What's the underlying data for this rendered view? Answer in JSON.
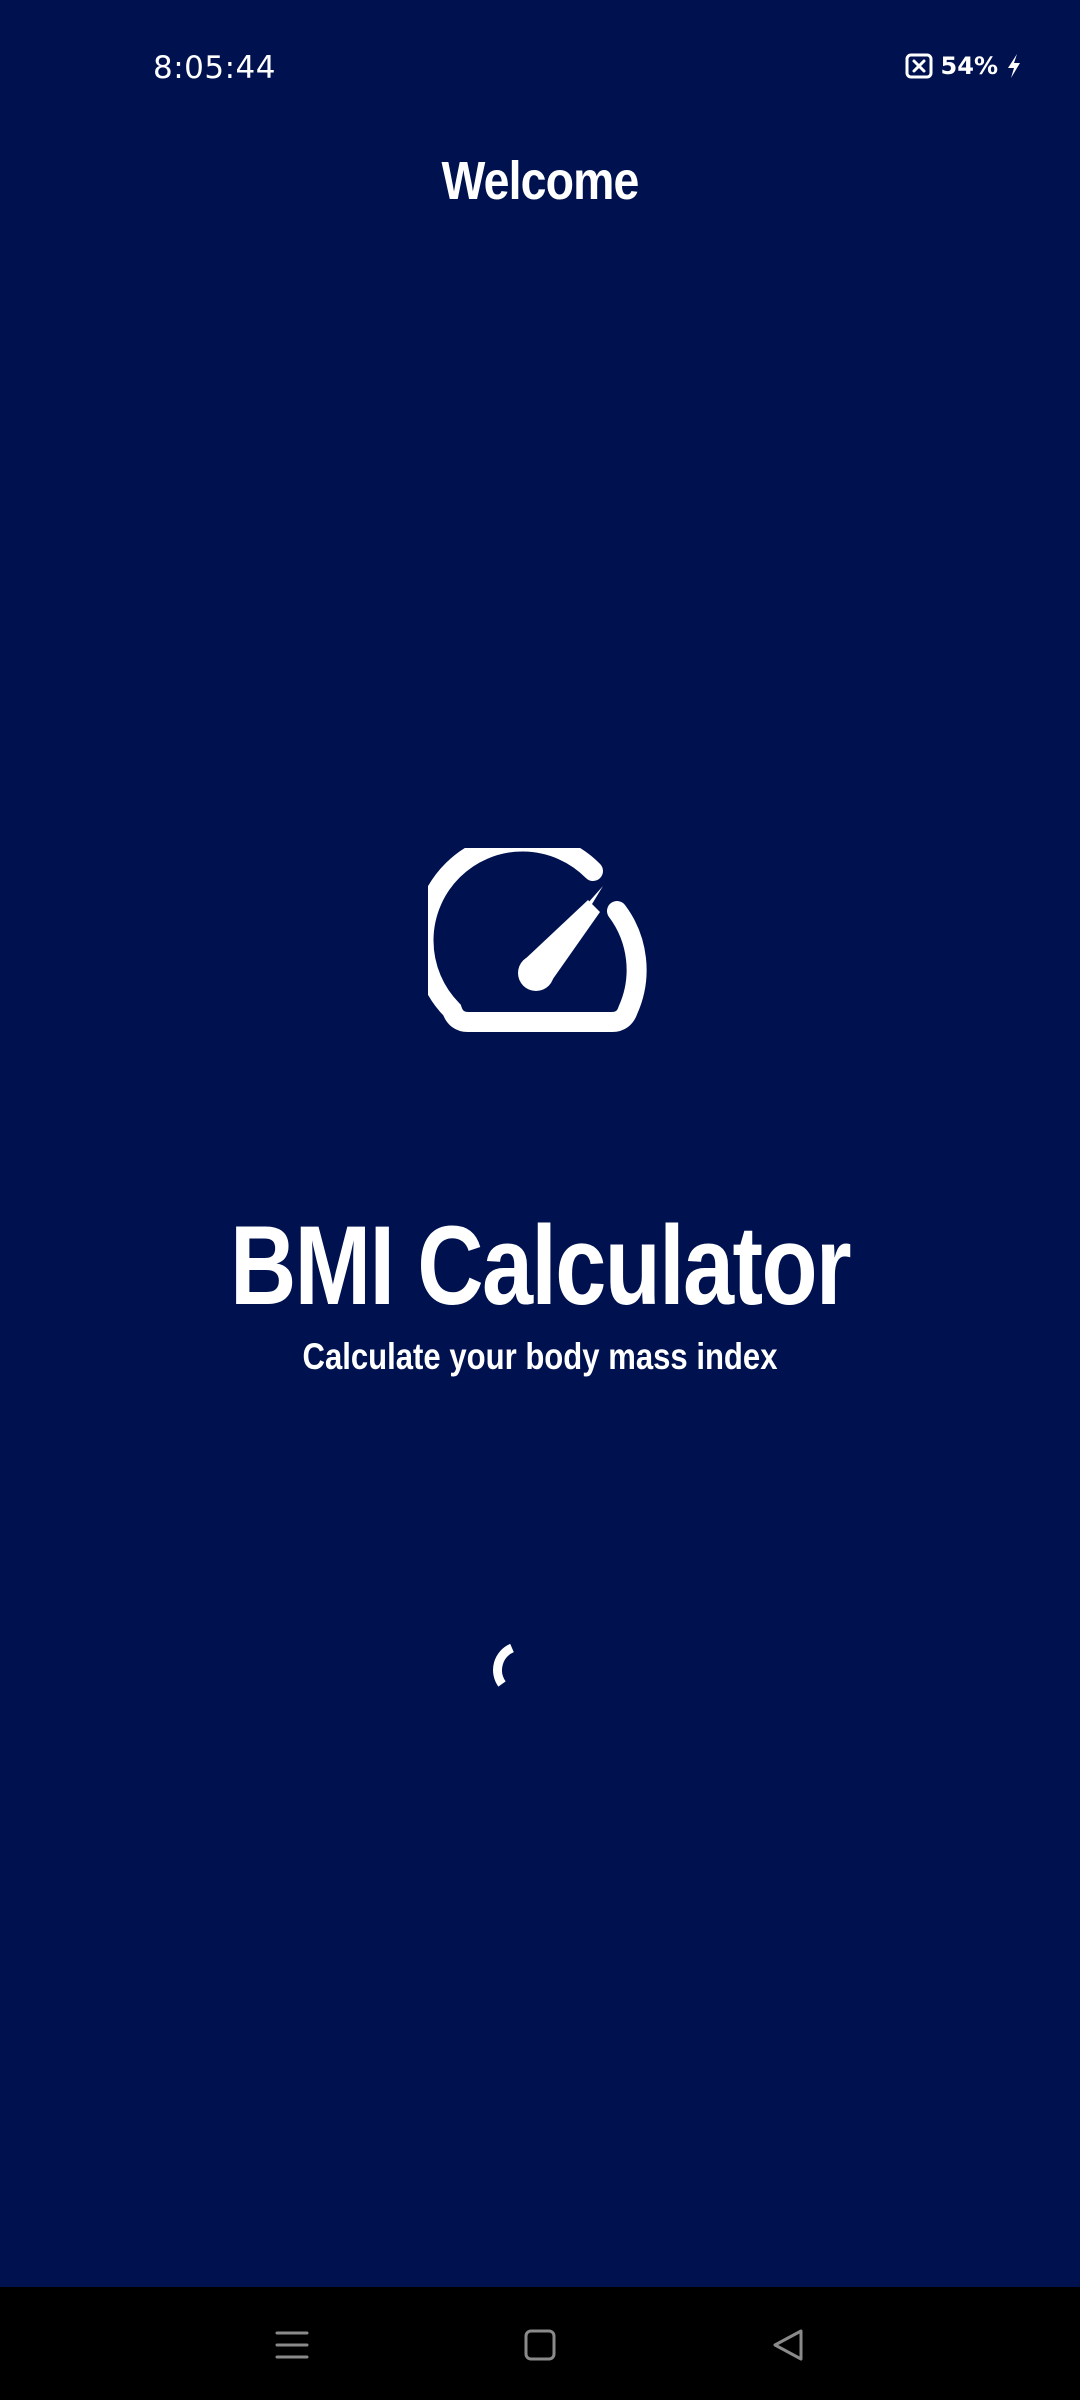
{
  "status_bar": {
    "time": "8:05:44",
    "battery_percent": "54%",
    "icons": [
      "notification-dismiss-icon",
      "battery-charging-icon"
    ]
  },
  "header": {
    "title": "Welcome"
  },
  "splash": {
    "icon": "speedometer-icon",
    "app_name": "BMI Calculator",
    "subtitle": "Calculate your body mass index",
    "loading_icon": "loading-spinner-icon"
  },
  "nav_bar": {
    "buttons": [
      "menu-icon",
      "home-icon",
      "back-icon"
    ]
  },
  "colors": {
    "background": "#00114F",
    "foreground": "#FFFFFF",
    "nav_background": "#000000"
  }
}
